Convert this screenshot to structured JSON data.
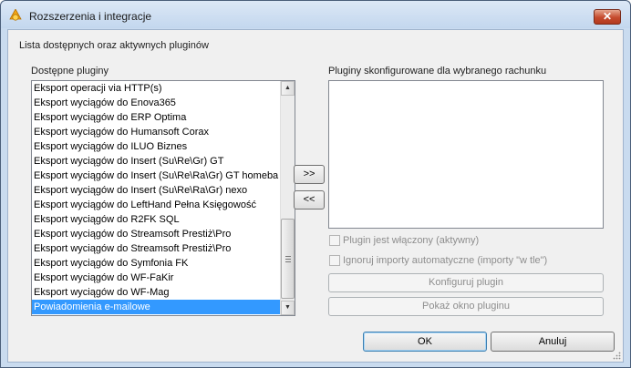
{
  "window": {
    "title": "Rozszerzenia i integracje",
    "close_label": "✕"
  },
  "header": {
    "subtitle": "Lista dostępnych oraz aktywnych pluginów"
  },
  "available": {
    "label": "Dostępne pluginy",
    "items": [
      "Eksport operacji via HTTP(s)",
      "Eksport wyciągów do Enova365",
      "Eksport wyciągów do ERP Optima",
      "Eksport wyciągów do Humansoft Corax",
      "Eksport wyciągów do ILUO Biznes",
      "Eksport wyciągów do Insert (Su\\Re\\Gr) GT",
      "Eksport wyciągów do Insert (Su\\Re\\Ra\\Gr) GT homeba",
      "Eksport wyciągów do Insert (Su\\Re\\Ra\\Gr) nexo",
      "Eksport wyciągów do LeftHand Pełna Księgowość",
      "Eksport wyciągów do R2FK SQL",
      "Eksport wyciągów do Streamsoft Prestiż\\Pro",
      "Eksport wyciągów do Streamsoft Prestiż\\Pro",
      "Eksport wyciągów do Symfonia FK",
      "Eksport wyciągów do WF-FaKir",
      "Eksport wyciągów do WF-Mag",
      "Powiadomienia e-mailowe"
    ],
    "selected_index": 15
  },
  "move": {
    "add_label": ">>",
    "remove_label": "<<"
  },
  "configured": {
    "label": "Pluginy skonfigurowane dla wybranego rachunku",
    "items": []
  },
  "options": {
    "enabled_label": "Plugin jest włączony (aktywny)",
    "enabled_checked": false,
    "ignore_label": "Ignoruj importy automatyczne (importy \"w tle\")",
    "ignore_checked": false
  },
  "actions": {
    "configure_label": "Konfiguruj plugin",
    "show_window_label": "Pokaż okno pluginu",
    "ok_label": "OK",
    "cancel_label": "Anuluj"
  },
  "colors": {
    "selection": "#3399ff",
    "close_button": "#c54a2c",
    "titlebar": "#c9dbef"
  }
}
